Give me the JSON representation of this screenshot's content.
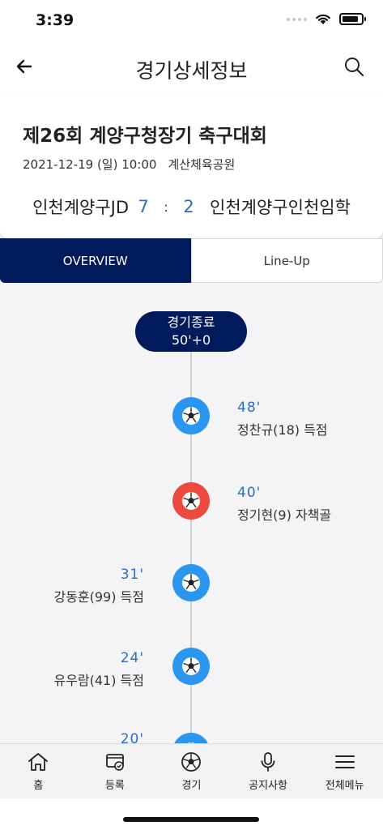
{
  "status_bar": {
    "time": "3:39",
    "battery_level": 0.85
  },
  "header": {
    "title": "경기상세정보",
    "back_icon": "arrow-left-icon",
    "search_icon": "search-icon"
  },
  "match": {
    "title": "제26회 계양구청장기 축구대회",
    "date": "2021-12-19 (일) 10:00",
    "venue": "계산체육공원",
    "home_team": "인천계양구JD",
    "home_score": "7",
    "separator": ":",
    "away_score": "2",
    "away_team": "인천계양구인천임학"
  },
  "tabs": [
    {
      "label": "OVERVIEW",
      "active": true
    },
    {
      "label": "Line-Up",
      "active": false
    }
  ],
  "timeline": {
    "end_label": "경기종료",
    "end_time": "50'+0",
    "events": [
      {
        "minute": "48'",
        "desc": "정찬규(18) 득점",
        "side": "right",
        "type": "goal"
      },
      {
        "minute": "40'",
        "desc": "정기현(9) 자책골",
        "side": "right",
        "type": "own-goal"
      },
      {
        "minute": "31'",
        "desc": "강동훈(99) 득점",
        "side": "left",
        "type": "goal"
      },
      {
        "minute": "24'",
        "desc": "유우람(41) 득점",
        "side": "left",
        "type": "goal"
      },
      {
        "minute": "20'",
        "desc": "",
        "side": "left",
        "type": "goal"
      }
    ]
  },
  "colors": {
    "navy": "#001a5c",
    "goal_blue": "#2a96f0",
    "own_goal_red": "#ec4a3f",
    "minute_blue": "#2a6fc5"
  },
  "bottom_nav": [
    {
      "label": "홈",
      "icon": "home-icon"
    },
    {
      "label": "등록",
      "icon": "registration-icon"
    },
    {
      "label": "경기",
      "icon": "soccer-ball-icon"
    },
    {
      "label": "공지사항",
      "icon": "microphone-icon"
    },
    {
      "label": "전체메뉴",
      "icon": "menu-icon"
    }
  ]
}
